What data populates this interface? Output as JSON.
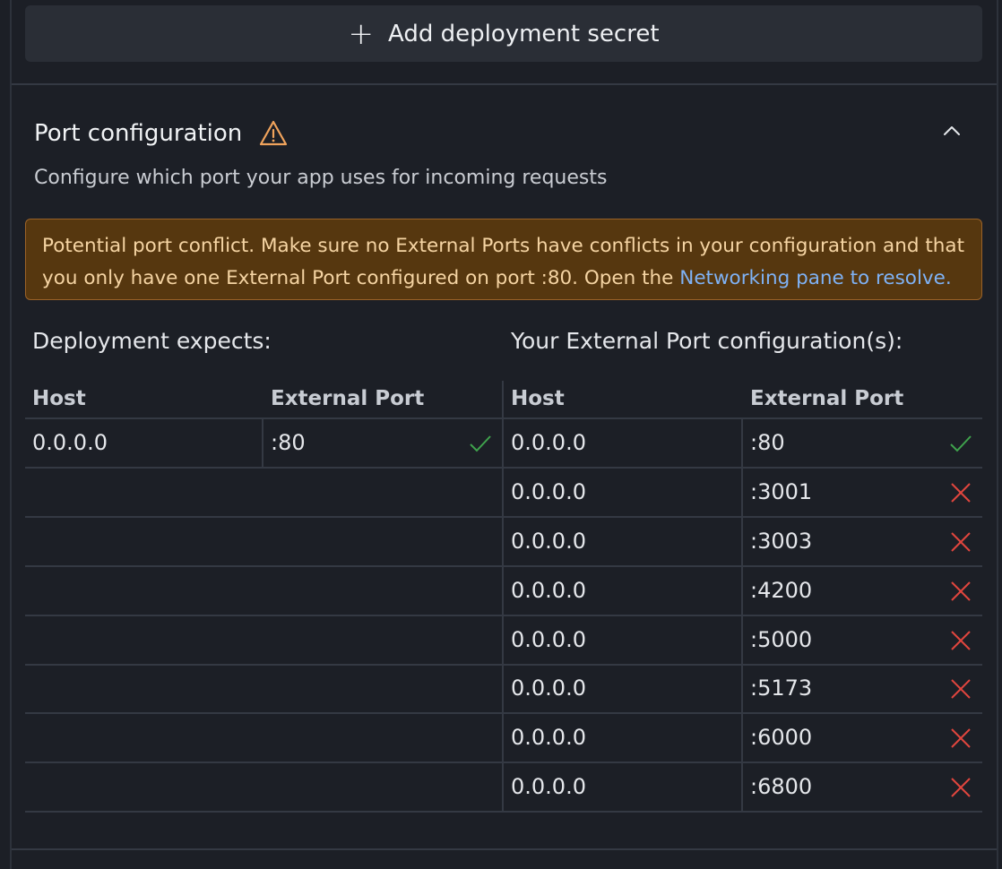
{
  "add_secret": {
    "label": "Add deployment secret",
    "icon": "plus-icon"
  },
  "port_config": {
    "title": "Port configuration",
    "subtitle": "Configure which port your app uses for incoming requests",
    "warning": {
      "text": "Potential port conflict. Make sure no External Ports have conflicts in your configuration and that you only have one External Port configured on port :80. Open the ",
      "link": "Networking pane to resolve."
    }
  },
  "deployment_expects": {
    "heading": "Deployment expects:",
    "columns": [
      "Host",
      "External Port"
    ],
    "rows": [
      {
        "host": "0.0.0.0",
        "port": ":80",
        "status": "ok"
      }
    ]
  },
  "external_config": {
    "heading": "Your External Port configuration(s):",
    "columns": [
      "Host",
      "External Port"
    ],
    "rows": [
      {
        "host": "0.0.0.0",
        "port": ":80",
        "status": "ok"
      },
      {
        "host": "0.0.0.0",
        "port": ":3001",
        "status": "error"
      },
      {
        "host": "0.0.0.0",
        "port": ":3003",
        "status": "error"
      },
      {
        "host": "0.0.0.0",
        "port": ":4200",
        "status": "error"
      },
      {
        "host": "0.0.0.0",
        "port": ":5000",
        "status": "error"
      },
      {
        "host": "0.0.0.0",
        "port": ":5173",
        "status": "error"
      },
      {
        "host": "0.0.0.0",
        "port": ":6000",
        "status": "error"
      },
      {
        "host": "0.0.0.0",
        "port": ":6800",
        "status": "error"
      }
    ]
  },
  "colors": {
    "ok": "#3fa34d",
    "error": "#e0453e",
    "warning": "#f0a35c",
    "link": "#7fb2f5"
  }
}
